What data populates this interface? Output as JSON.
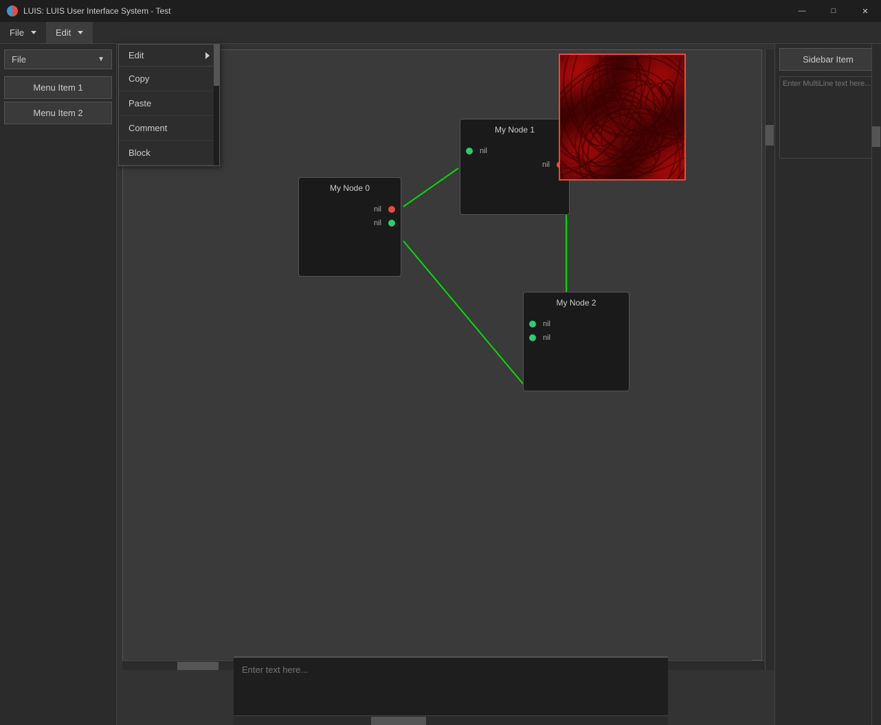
{
  "titleBar": {
    "title": "LUIS: LUIS User Interface System - Test",
    "minimize": "—",
    "maximize": "□",
    "close": "✕"
  },
  "menuBar": {
    "fileLabel": "File",
    "fileArrow": "▼",
    "editLabel": "Edit",
    "editArrow": "▼"
  },
  "dropdown": {
    "header": "Edit",
    "items": [
      "Copy",
      "Paste",
      "Comment",
      "Block"
    ]
  },
  "leftSidebar": {
    "fileButton": "File",
    "menuItem1": "Menu Item 1",
    "menuItem2": "Menu Item 2"
  },
  "rightSidebar": {
    "sidebarItemLabel": "Sidebar Item",
    "textareaPlaceholder": "Enter MultiLine text here..."
  },
  "nodes": [
    {
      "id": "node0",
      "title": "My Node 0",
      "ports": [
        {
          "type": "output",
          "label": "nil",
          "color": "red"
        },
        {
          "type": "output",
          "label": "nil",
          "color": "green"
        }
      ]
    },
    {
      "id": "node1",
      "title": "My Node 1",
      "ports": [
        {
          "type": "input",
          "label": "nil",
          "color": "green"
        },
        {
          "type": "output",
          "label": "nil",
          "color": "red"
        }
      ]
    },
    {
      "id": "node2",
      "title": "My Node 2",
      "ports": [
        {
          "type": "input",
          "label": "nil",
          "color": "green"
        },
        {
          "type": "input",
          "label": "nil",
          "color": "green"
        }
      ]
    }
  ],
  "bottomBar": {
    "placeholder": "Enter text here..."
  }
}
